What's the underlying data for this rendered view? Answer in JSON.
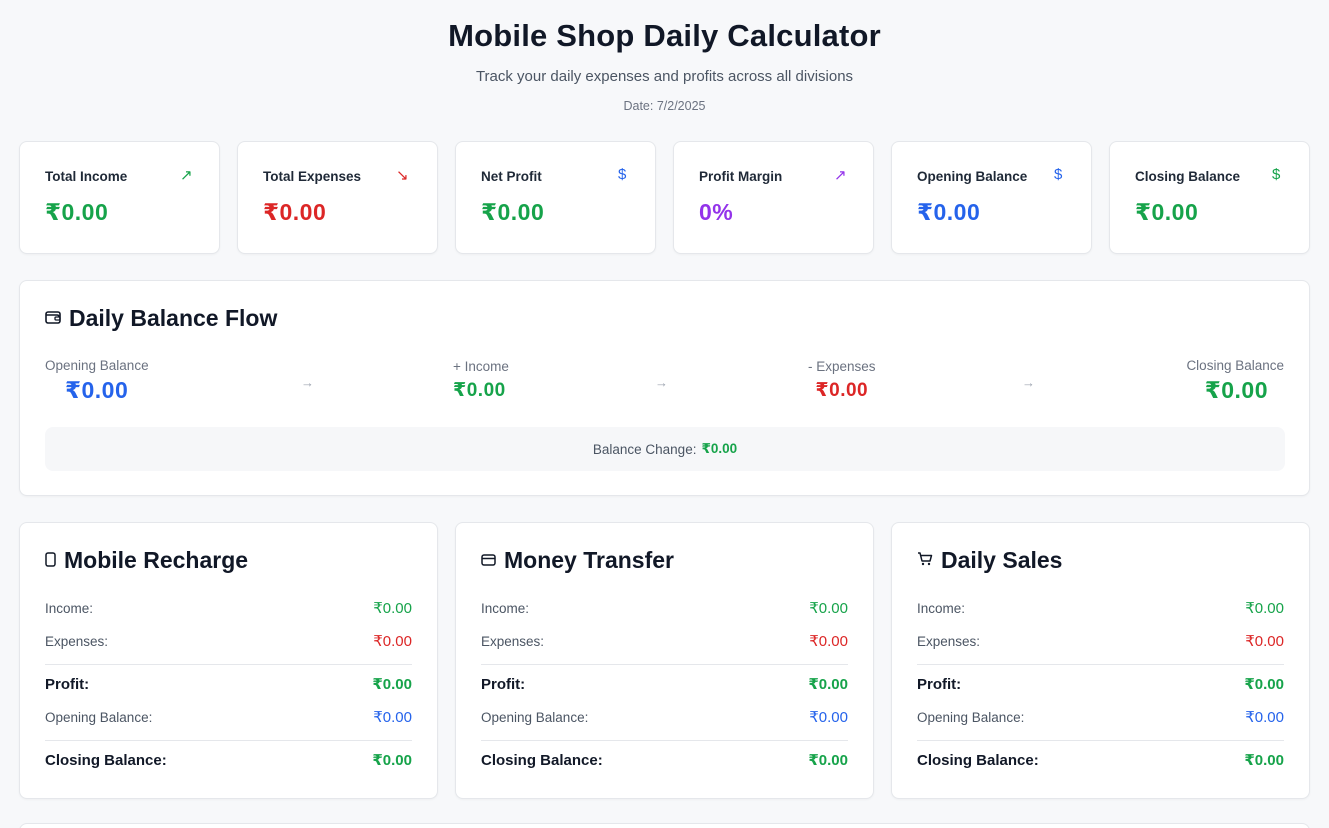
{
  "header": {
    "title": "Mobile Shop Daily Calculator",
    "subtitle": "Track your daily expenses and profits across all divisions",
    "date": "Date: 7/2/2025"
  },
  "stats": [
    {
      "label": "Total Income",
      "value": "₹0.00",
      "icon": "trending-up-icon",
      "glyph": "↗",
      "color": "#16a34a"
    },
    {
      "label": "Total Expenses",
      "value": "₹0.00",
      "icon": "trending-down-icon",
      "glyph": "↘",
      "color": "#dc2626"
    },
    {
      "label": "Net Profit",
      "value": "₹0.00",
      "icon": "dollar-sign-icon",
      "glyph": "$",
      "color": "#16a34a"
    },
    {
      "label": "Profit Margin",
      "value": "0%",
      "icon": "trending-up-icon",
      "glyph": "↗",
      "color": "#9333ea"
    },
    {
      "label": "Opening Balance",
      "value": "₹0.00",
      "icon": "dollar-sign-icon",
      "glyph": "$",
      "color": "#2563eb"
    },
    {
      "label": "Closing Balance",
      "value": "₹0.00",
      "icon": "dollar-sign-icon",
      "glyph": "$",
      "color": "#16a34a"
    }
  ],
  "flow": {
    "title": "Daily Balance Flow",
    "opening_label": "Opening Balance",
    "opening_value": "₹0.00",
    "income_label": "+ Income",
    "income_value": "₹0.00",
    "expenses_label": "- Expenses",
    "expenses_value": "₹0.00",
    "closing_label": "Closing Balance",
    "closing_value": "₹0.00",
    "change_label": "Balance Change:",
    "change_value": "₹0.00"
  },
  "divisions": [
    {
      "title": "Mobile Recharge",
      "icon": "smartphone-icon",
      "income_label": "Income:",
      "income": "₹0.00",
      "expenses_label": "Expenses:",
      "expenses": "₹0.00",
      "profit_label": "Profit:",
      "profit": "₹0.00",
      "opening_label": "Opening Balance:",
      "opening": "₹0.00",
      "closing_label": "Closing Balance:",
      "closing": "₹0.00"
    },
    {
      "title": "Money Transfer",
      "icon": "credit-card-icon",
      "income_label": "Income:",
      "income": "₹0.00",
      "expenses_label": "Expenses:",
      "expenses": "₹0.00",
      "profit_label": "Profit:",
      "profit": "₹0.00",
      "opening_label": "Opening Balance:",
      "opening": "₹0.00",
      "closing_label": "Closing Balance:",
      "closing": "₹0.00"
    },
    {
      "title": "Daily Sales",
      "icon": "shopping-cart-icon",
      "income_label": "Income:",
      "income": "₹0.00",
      "expenses_label": "Expenses:",
      "expenses": "₹0.00",
      "profit_label": "Profit:",
      "profit": "₹0.00",
      "opening_label": "Opening Balance:",
      "opening": "₹0.00",
      "closing_label": "Closing Balance:",
      "closing": "₹0.00"
    }
  ]
}
